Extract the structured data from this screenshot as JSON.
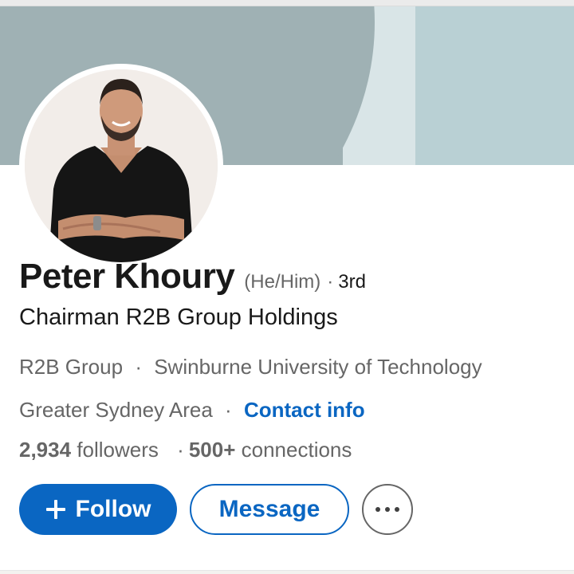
{
  "profile": {
    "name": "Peter Khoury",
    "pronouns": "(He/Him)",
    "degree_sep": "·",
    "degree": "3rd",
    "headline": "Chairman R2B Group Holdings",
    "company": "R2B Group",
    "education_sep": "·",
    "school": "Swinburne University of Technology",
    "location": "Greater Sydney Area",
    "location_sep": "·",
    "contact_label": "Contact info",
    "followers_count": "2,934",
    "followers_label": "followers",
    "stats_sep": "·",
    "connections_count": "500+",
    "connections_label": "connections"
  },
  "actions": {
    "follow_label": "Follow",
    "message_label": "Message",
    "more_icon": "more-horizontal-icon",
    "follow_icon": "plus-icon"
  },
  "colors": {
    "accent": "#0a66c2",
    "banner": "#9fb1b4",
    "banner_light": "#b9d0d4",
    "secondary_text": "#666666"
  }
}
